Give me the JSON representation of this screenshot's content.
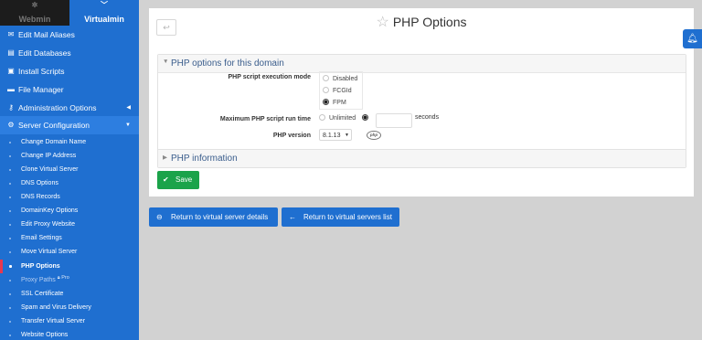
{
  "tabs": {
    "webmin": "Webmin",
    "virtualmin": "Virtualmin"
  },
  "sidebar": {
    "items": [
      {
        "label": "Edit Mail Aliases",
        "icon": "mail-icon"
      },
      {
        "label": "Edit Databases",
        "icon": "database-icon"
      },
      {
        "label": "Install Scripts",
        "icon": "scripts-icon"
      },
      {
        "label": "File Manager",
        "icon": "folder-icon"
      },
      {
        "label": "Administration Options",
        "icon": "key-icon"
      },
      {
        "label": "Server Configuration",
        "icon": "gears-icon"
      }
    ],
    "subitems": [
      "Change Domain Name",
      "Change IP Address",
      "Clone Virtual Server",
      "DNS Options",
      "DNS Records",
      "DomainKey Options",
      "Edit Proxy Website",
      "Email Settings",
      "Move Virtual Server",
      "PHP Options",
      "Proxy Paths",
      "SSL Certificate",
      "Spam and Virus Delivery",
      "Transfer Virtual Server",
      "Website Options"
    ],
    "active_subitem": "PHP Options",
    "pro_badge": "Pro"
  },
  "page": {
    "title": "PHP Options"
  },
  "form": {
    "section_title": "PHP options for this domain",
    "exec_mode_label": "PHP script execution mode",
    "exec_modes": [
      "Disabled",
      "FCGId",
      "FPM"
    ],
    "exec_mode_selected": "FPM",
    "max_runtime_label": "Maximum PHP script run time",
    "runtime_unlimited": "Unlimited",
    "runtime_value": "",
    "runtime_units": "seconds",
    "php_version_label": "PHP version",
    "php_version": "8.1.13",
    "php_logo": "php"
  },
  "info_section_title": "PHP information",
  "buttons": {
    "save": "Save",
    "return_details": "Return to virtual server details",
    "return_list": "Return to virtual servers list"
  },
  "colors": {
    "sidebar": "#1f6fd0",
    "save": "#1ba34a",
    "active_marker": "#e8384f"
  }
}
